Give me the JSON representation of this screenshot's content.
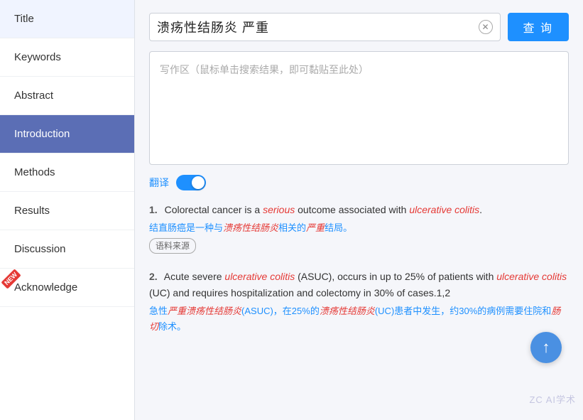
{
  "sidebar": {
    "items": [
      {
        "id": "title",
        "label": "Title",
        "active": false,
        "new": false
      },
      {
        "id": "keywords",
        "label": "Keywords",
        "active": false,
        "new": false
      },
      {
        "id": "abstract",
        "label": "Abstract",
        "active": false,
        "new": false
      },
      {
        "id": "introduction",
        "label": "Introduction",
        "active": true,
        "new": false
      },
      {
        "id": "methods",
        "label": "Methods",
        "active": false,
        "new": false
      },
      {
        "id": "results",
        "label": "Results",
        "active": false,
        "new": false
      },
      {
        "id": "discussion",
        "label": "Discussion",
        "active": false,
        "new": false
      },
      {
        "id": "acknowledge",
        "label": "Acknowledge",
        "active": false,
        "new": true
      }
    ]
  },
  "search": {
    "query": "溃疡性结肠炎 严重",
    "button_label": "查 询",
    "clear_title": "clear"
  },
  "writing_area": {
    "placeholder": "写作区（鼠标单击搜索结果，即可黏贴至此处）"
  },
  "translate": {
    "label": "翻译",
    "enabled": true
  },
  "results": [
    {
      "number": "1",
      "english": "Colorectal cancer is a <em>serious</em> outcome associated with <em>ulcerative colitis</em>.",
      "chinese": "结直肠癌是一种与<em>溃疡性结肠炎</em>相关的<em>严重</em>结局。",
      "corpus_label": "语料来源"
    },
    {
      "number": "2",
      "english": "Acute severe <em>ulcerative colitis</em> (ASUC), occurs in up to 25% of patients with <em>ulcerative colitis</em> (UC) and requires hospitalization and colectomy in 30% of cases.1,2",
      "chinese": "急性<em>严重溃疡性结肠炎</em>(ASUC)，在25%的<em>溃疡性结肠炎</em>(UC)患者中发生，约30%的病例需要住院和<em>肠切</em>除术。",
      "corpus_label": ""
    }
  ],
  "new_badge_label": "NEW",
  "watermark": "ZC AI学术"
}
